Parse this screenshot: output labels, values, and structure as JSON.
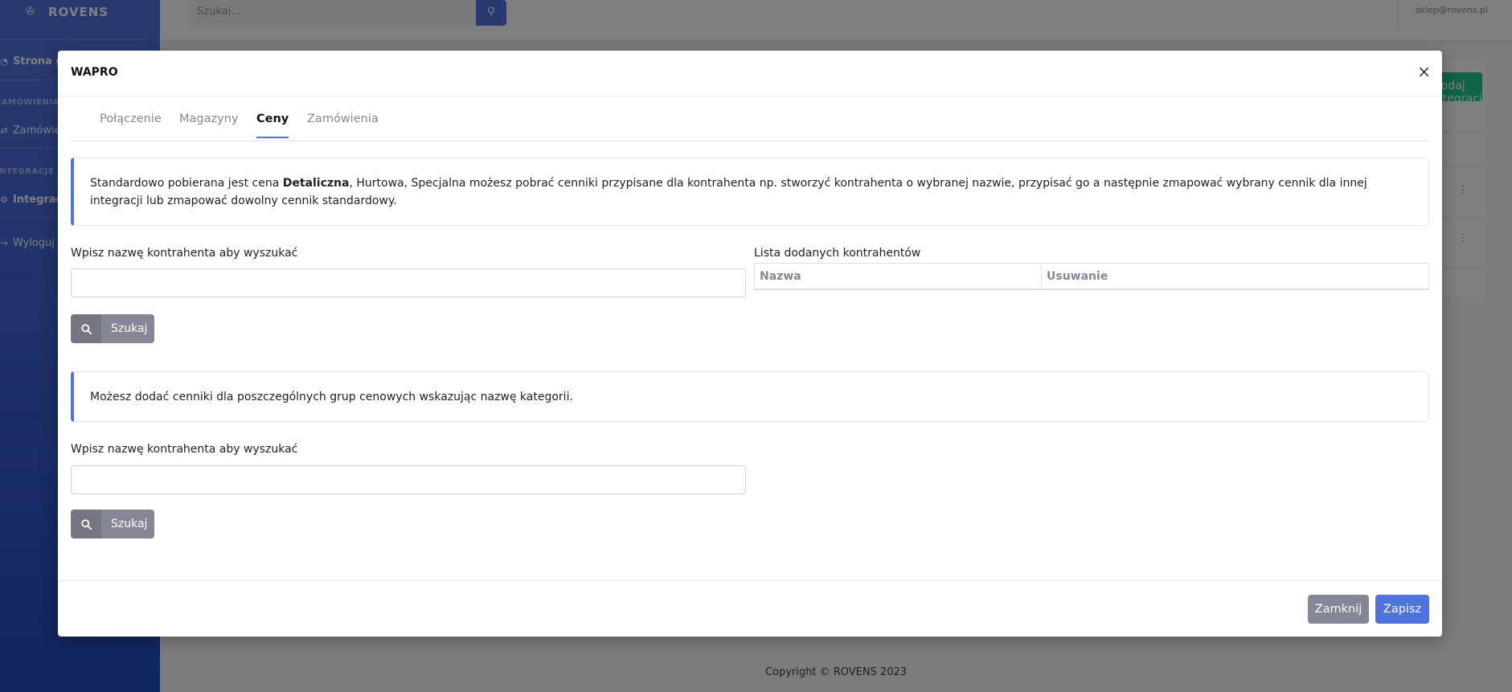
{
  "app": {
    "brand": "ROVENS",
    "search_placeholder": "Szukaj...",
    "user_email": "sklep@rovens.pl",
    "sidebar": {
      "home": "Strona główna",
      "section_orders": "ZAMÓWIENIA",
      "orders": "Zamówienia",
      "section_integrations": "INTEGRACJE",
      "integrations": "Integracje",
      "logout": "Wyloguj"
    },
    "add_button": "Dodaj integracje",
    "footer": "Copyright © ROVENS 2023"
  },
  "modal": {
    "title": "WAPRO",
    "close_symbol": "×",
    "tabs": [
      {
        "label": "Połączenie",
        "active": false
      },
      {
        "label": "Magazyny",
        "active": false
      },
      {
        "label": "Ceny",
        "active": true
      },
      {
        "label": "Zamówienia",
        "active": false
      }
    ],
    "info1": {
      "before": "Standardowo pobierana jest cena ",
      "bold": "Detaliczna",
      "after": ", Hurtowa, Specjalna możesz pobrać cenniki przypisane dla kontrahenta np. stworzyć kontrahenta o wybranej nazwie, przypisać go a następnie zmapować wybrany cennik dla innej integracji lub zmapować dowolny cennik standardowy."
    },
    "search1": {
      "label": "Wpisz nazwę kontrahenta aby wyszukać",
      "value": "",
      "button": "Szukaj"
    },
    "list": {
      "title": "Lista dodanych kontrahentów",
      "columns": [
        "Nazwa",
        "Usuwanie"
      ]
    },
    "info2": "Możesz dodać cenniki dla poszczególnych grup cenowych wskazując nazwę kategorii.",
    "search2": {
      "label": "Wpisz nazwę kontrahenta aby wyszukać",
      "value": "",
      "button": "Szukaj"
    },
    "footer": {
      "close": "Zamknij",
      "save": "Zapisz"
    }
  },
  "colors": {
    "primary": "#4e73df",
    "secondary": "#858796",
    "success": "#1cc88a"
  },
  "icons": [
    "brand-logo-icon",
    "search-icon",
    "close-icon",
    "tachometer-icon",
    "orders-icon",
    "integrations-icon",
    "logout-icon",
    "kebab-menu-icon"
  ]
}
